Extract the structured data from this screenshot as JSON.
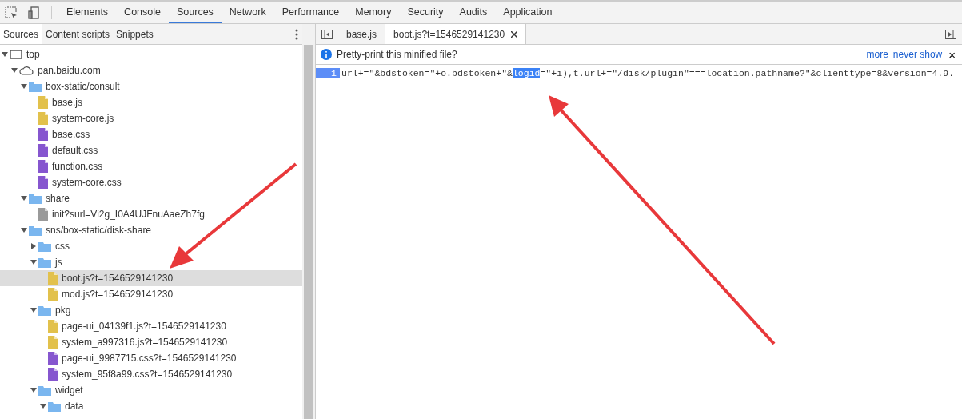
{
  "main_tabs": [
    {
      "label": "Elements",
      "selected": false
    },
    {
      "label": "Console",
      "selected": false
    },
    {
      "label": "Sources",
      "selected": true
    },
    {
      "label": "Network",
      "selected": false
    },
    {
      "label": "Performance",
      "selected": false
    },
    {
      "label": "Memory",
      "selected": false
    },
    {
      "label": "Security",
      "selected": false
    },
    {
      "label": "Audits",
      "selected": false
    },
    {
      "label": "Application",
      "selected": false
    }
  ],
  "navigator": {
    "tabs": [
      {
        "label": "Sources",
        "selected": true
      },
      {
        "label": "Content scripts",
        "selected": false
      },
      {
        "label": "Snippets",
        "selected": false
      }
    ],
    "tree": [
      {
        "kind": "frame",
        "label": "top",
        "expanded": true,
        "selected": false,
        "children": [
          {
            "kind": "domain",
            "label": "pan.baidu.com",
            "expanded": true,
            "selected": false,
            "children": [
              {
                "kind": "folder",
                "label": "box-static/consult",
                "expanded": true,
                "selected": false,
                "children": [
                  {
                    "kind": "file",
                    "label": "base.js",
                    "color": "#e2c14c",
                    "selected": false
                  },
                  {
                    "kind": "file",
                    "label": "system-core.js",
                    "color": "#e2c14c",
                    "selected": false
                  },
                  {
                    "kind": "file",
                    "label": "base.css",
                    "color": "#8656cf",
                    "selected": false
                  },
                  {
                    "kind": "file",
                    "label": "default.css",
                    "color": "#8656cf",
                    "selected": false
                  },
                  {
                    "kind": "file",
                    "label": "function.css",
                    "color": "#8656cf",
                    "selected": false
                  },
                  {
                    "kind": "file",
                    "label": "system-core.css",
                    "color": "#8656cf",
                    "selected": false
                  }
                ]
              },
              {
                "kind": "folder",
                "label": "share",
                "expanded": true,
                "selected": false,
                "children": [
                  {
                    "kind": "file",
                    "label": "init?surl=Vi2g_I0A4UJFnuAaeZh7fg",
                    "color": "#9a9a9a",
                    "selected": false
                  }
                ]
              },
              {
                "kind": "folder",
                "label": "sns/box-static/disk-share",
                "expanded": true,
                "selected": false,
                "children": [
                  {
                    "kind": "folder",
                    "label": "css",
                    "expanded": false,
                    "selected": false
                  },
                  {
                    "kind": "folder",
                    "label": "js",
                    "expanded": true,
                    "selected": false,
                    "children": [
                      {
                        "kind": "file",
                        "label": "boot.js?t=1546529141230",
                        "color": "#e2c14c",
                        "selected": true
                      },
                      {
                        "kind": "file",
                        "label": "mod.js?t=1546529141230",
                        "color": "#e2c14c",
                        "selected": false
                      }
                    ]
                  },
                  {
                    "kind": "folder",
                    "label": "pkg",
                    "expanded": true,
                    "selected": false,
                    "children": [
                      {
                        "kind": "file",
                        "label": "page-ui_04139f1.js?t=1546529141230",
                        "color": "#e2c14c",
                        "selected": false
                      },
                      {
                        "kind": "file",
                        "label": "system_a997316.js?t=1546529141230",
                        "color": "#e2c14c",
                        "selected": false
                      },
                      {
                        "kind": "file",
                        "label": "page-ui_9987715.css?t=1546529141230",
                        "color": "#8656cf",
                        "selected": false
                      },
                      {
                        "kind": "file",
                        "label": "system_95f8a99.css?t=1546529141230",
                        "color": "#8656cf",
                        "selected": false
                      }
                    ]
                  },
                  {
                    "kind": "folder",
                    "label": "widget",
                    "expanded": true,
                    "selected": false,
                    "children": [
                      {
                        "kind": "folder",
                        "label": "data",
                        "expanded": true,
                        "selected": false
                      }
                    ]
                  }
                ]
              }
            ]
          }
        ]
      }
    ]
  },
  "editor": {
    "tabs": [
      {
        "label": "base.js",
        "selected": false,
        "closable": false
      },
      {
        "label": "boot.js?t=1546529141230",
        "selected": true,
        "closable": true
      }
    ],
    "infobar": {
      "message": "Pretty-print this minified file?",
      "links": [
        "more",
        "never show"
      ],
      "close": "×"
    },
    "lines": [
      {
        "number": "1",
        "segments": [
          {
            "text": "url+=\"&bdstoken=\"+o.bdstoken+\"&",
            "selected": false
          },
          {
            "text": "logid",
            "selected": true
          },
          {
            "text": "=\"+i),t.url+=\"/disk/plugin\"===location.pathname?\"&clienttype=8&version=4.9.",
            "selected": false
          }
        ]
      }
    ]
  }
}
